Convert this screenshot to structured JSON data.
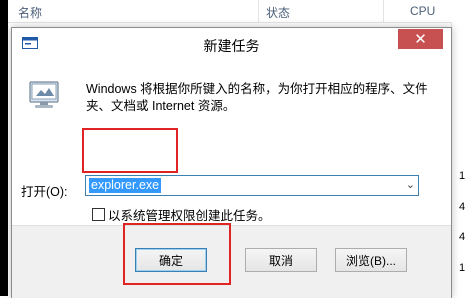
{
  "background": {
    "col_name": "名称",
    "col_status": "状态",
    "col_cpu": "CPU",
    "side_numbers": [
      "1",
      "4",
      "4",
      "1"
    ]
  },
  "dialog": {
    "title": "新建任务",
    "close_glyph": "✕",
    "description": "Windows 将根据你所键入的名称，为你打开相应的程序、文件夹、文档或 Internet 资源。",
    "open_label": "打开(O):",
    "open_value": "explorer.exe",
    "admin_checkbox_label": "以系统管理权限创建此任务。",
    "admin_checked": false,
    "ok_label": "确定",
    "cancel_label": "取消",
    "browse_label": "浏览(B)..."
  },
  "colors": {
    "annotation": "#e02424",
    "close_button": "#c75050",
    "selection": "#3399ff"
  }
}
